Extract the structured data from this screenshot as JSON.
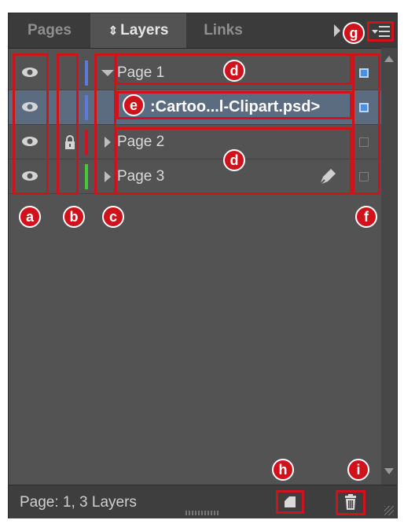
{
  "tabs": [
    {
      "label": "Pages"
    },
    {
      "label": "Layers",
      "sort_glyph": "⇕"
    },
    {
      "label": "Links"
    }
  ],
  "layers": [
    {
      "name": "Page 1",
      "color": "#5a7bd8",
      "expanded": true,
      "selected": true
    },
    {
      "name": "Page 2",
      "color": "#d0121b",
      "locked": true,
      "expanded": false
    },
    {
      "name": "Page 3",
      "color": "#46c83a",
      "expanded": false,
      "has_pen": true
    }
  ],
  "sublayer_item": {
    "name": ":Cartoo...l-Clipart.psd>",
    "color": "#5a7bd8",
    "selected": true
  },
  "status": {
    "text": "Page: 1, 3 Layers"
  },
  "callouts": [
    "a",
    "b",
    "c",
    "d",
    "d",
    "e",
    "f",
    "g",
    "h",
    "i"
  ],
  "colors": {
    "panel": "#535353",
    "tabbar": "#3b3b3b",
    "callout_red": "#d0121b",
    "selection_blue": "#4b8ee8"
  }
}
